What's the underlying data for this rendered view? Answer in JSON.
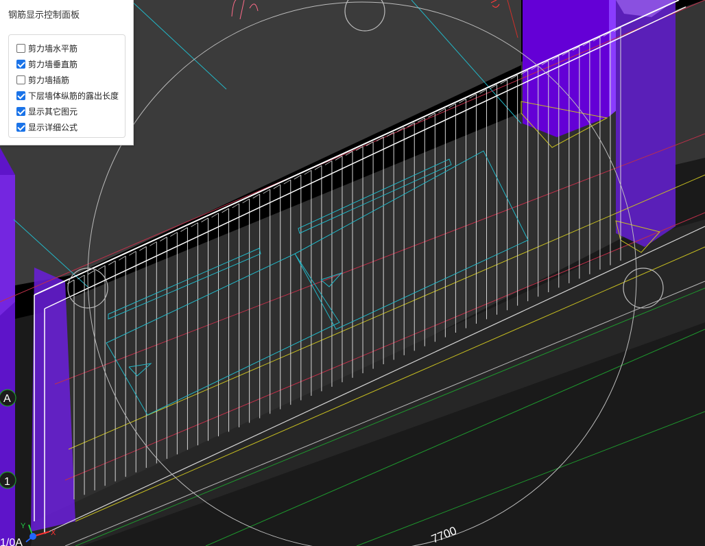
{
  "panel": {
    "title": "钢筋显示控制面板",
    "options": [
      {
        "label": "剪力墙水平筋",
        "checked": false
      },
      {
        "label": "剪力墙垂直筋",
        "checked": true
      },
      {
        "label": "剪力墙插筋",
        "checked": false
      },
      {
        "label": "下层墙体纵筋的露出长度",
        "checked": true
      },
      {
        "label": "显示其它图元",
        "checked": true
      },
      {
        "label": "显示详细公式",
        "checked": true
      }
    ]
  },
  "viewport": {
    "dimension_label": "7700",
    "axis_labels": {
      "a": "A",
      "one": "1",
      "one_a": "1/0A"
    },
    "gizmo": {
      "x": "X",
      "y": "Y"
    },
    "colors": {
      "background": "#000000",
      "floor": "#3a3a3a",
      "wall_face": "#2d2d2d",
      "column": "#6a00d8",
      "rebar": "#d8d8d8",
      "cyan": "#22b8c8",
      "red": "#c0304a",
      "yellow": "#c9c020",
      "green": "#1e9a2e"
    }
  }
}
